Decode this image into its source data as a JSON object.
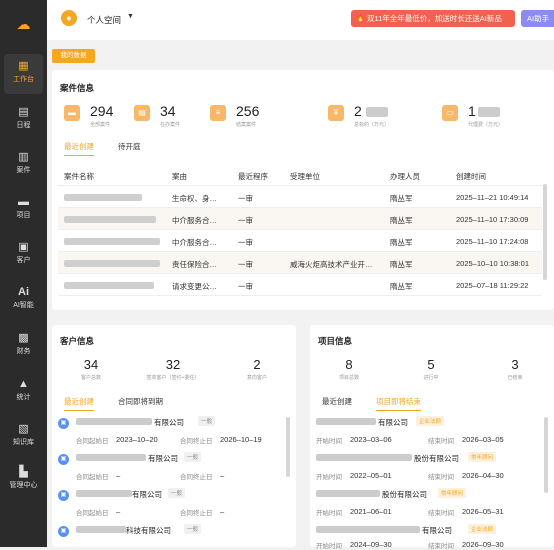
{
  "sidebar": {
    "items": [
      {
        "label": "工作台",
        "icon": "grid-icon"
      },
      {
        "label": "日程",
        "icon": "calendar-icon"
      },
      {
        "label": "案件",
        "icon": "case-icon"
      },
      {
        "label": "项目",
        "icon": "folder-icon"
      },
      {
        "label": "客户",
        "icon": "briefcase-icon"
      },
      {
        "label": "AI智能",
        "icon": "ai-icon"
      },
      {
        "label": "财务",
        "icon": "finance-icon"
      },
      {
        "label": "统计",
        "icon": "chart-icon"
      },
      {
        "label": "知识库",
        "icon": "book-icon"
      },
      {
        "label": "管理中心",
        "icon": "building-icon"
      }
    ]
  },
  "topbar": {
    "space": "个人空间",
    "promo": "双11年全年最低价，加送时长还送AI新品",
    "ai_label": "AI助手"
  },
  "workspace_tab": "我的数据",
  "case": {
    "title": "案件信息",
    "stats": [
      {
        "value": "294",
        "label": "全部案件"
      },
      {
        "value": "34",
        "label": "在办案件"
      },
      {
        "value": "256",
        "label": "结案案件"
      },
      {
        "value": "2",
        "label": "总标的（万元）"
      },
      {
        "value": "1",
        "label": "代理费（万元）"
      }
    ],
    "tabs": [
      "最近创建",
      "待开庭"
    ],
    "columns": [
      "案件名称",
      "案由",
      "最近程序",
      "受理单位",
      "办理人员",
      "创建时间"
    ],
    "rows": [
      {
        "cause": "生命权、身…",
        "stage": "一审",
        "court": "",
        "handler": "隋丛军",
        "created": "2025–11–21 10:49:14"
      },
      {
        "cause": "中介服务合…",
        "stage": "一审",
        "court": "",
        "handler": "隋丛军",
        "created": "2025–11–10 17:30:09"
      },
      {
        "cause": "中介服务合…",
        "stage": "一审",
        "court": "",
        "handler": "隋丛军",
        "created": "2025–11–10 17:24:08"
      },
      {
        "cause": "责任保险合…",
        "stage": "一审",
        "court": "威海火炬高技术产业开…",
        "handler": "隋丛军",
        "created": "2025–10–10 10:38:01"
      },
      {
        "cause": "请求变更公…",
        "stage": "一审",
        "court": "",
        "handler": "隋丛军",
        "created": "2025–07–18 11:29:22"
      }
    ]
  },
  "customers": {
    "title": "客户信息",
    "stats": [
      {
        "value": "34",
        "label": "客户总数"
      },
      {
        "value": "32",
        "label": "签单客户（签约+委任）"
      },
      {
        "value": "2",
        "label": "意向客户"
      }
    ],
    "tabs": [
      "最近创建",
      "合同即将到期"
    ],
    "start_label": "合同起始日",
    "end_label": "合同终止日",
    "items": [
      {
        "name": "有限公司",
        "tag": "一般",
        "start": "2023–10–20",
        "end": "2026–10–19"
      },
      {
        "name": "有限公司",
        "tag": "一般",
        "start": "–",
        "end": "–"
      },
      {
        "name": "有限公司",
        "tag": "一般",
        "start": "–",
        "end": "–"
      },
      {
        "name": "科技有限公司",
        "tag": "一般",
        "start": "",
        "end": ""
      }
    ]
  },
  "projects": {
    "title": "项目信息",
    "stats": [
      {
        "value": "8",
        "label": "项目总数"
      },
      {
        "value": "5",
        "label": "进行中"
      },
      {
        "value": "3",
        "label": "已结束"
      }
    ],
    "tabs": [
      "最近创建",
      "项目即将结束"
    ],
    "start_label": "开始时间",
    "end_label": "结束时间",
    "items": [
      {
        "name": "有限公司",
        "tag": "企业法顾",
        "start": "2023–03–06",
        "end": "2026–03–05"
      },
      {
        "name": "股份有限公司",
        "tag": "常年顾问",
        "start": "2022–05–01",
        "end": "2026–04–30"
      },
      {
        "name": "股份有限公司",
        "tag": "常年顾问",
        "start": "2021–06–01",
        "end": "2026–05–31"
      },
      {
        "name": "有限公司",
        "tag": "企业法顾",
        "start": "2024–09–30",
        "end": "2026–09–30"
      }
    ]
  }
}
